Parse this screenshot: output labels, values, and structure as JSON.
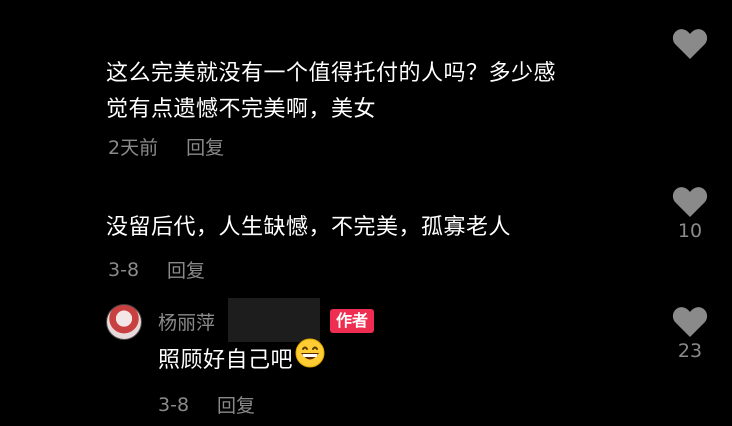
{
  "comments": [
    {
      "text_line1": "这么完美就没有一个值得托付的人吗？多少感",
      "text_line2": "觉有点遗憾不完美啊，美女",
      "time": "2天前",
      "reply_label": "回复",
      "likes": ""
    },
    {
      "text_line1": "没留后代，人生缺憾，不完美，孤寡老人",
      "time": "3-8",
      "reply_label": "回复",
      "likes": "10"
    },
    {
      "author": "杨丽萍",
      "badge": "作者",
      "text_line1": "照顾好自己吧",
      "emoji": "grinning-face-icon",
      "time": "3-8",
      "reply_label": "回复",
      "likes": "23"
    }
  ],
  "colors": {
    "background": "#000000",
    "text": "#ffffff",
    "meta": "#8a8a8a",
    "badge": "#ef2d50"
  }
}
